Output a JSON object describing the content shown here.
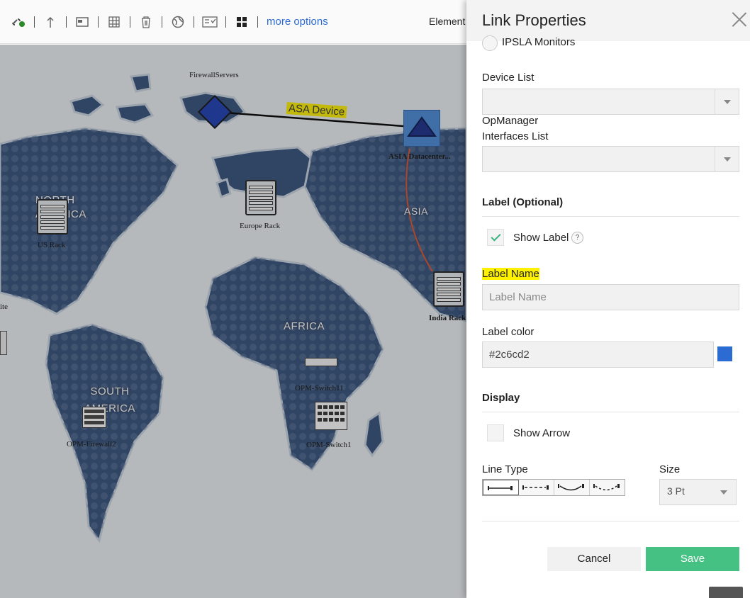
{
  "toolbar": {
    "more_options": "more options",
    "elements_label": "Element"
  },
  "map": {
    "continents": {
      "north_america": "NORTH AMERICA",
      "south_america": "SOUTH AMERICA",
      "africa": "AFRICA",
      "asia": "ASIA"
    },
    "devices": {
      "firewall_servers": "FirewallServers",
      "asia_datacenter": "ASIA Datacenter...",
      "us_rack": "US Rack",
      "europe_rack": "Europe Rack",
      "india_rack": "India Rack",
      "opm_switch11": "OPM-Switch11",
      "opm_switch1": "OPM-Switch1",
      "opm_firewall2": "OPM-Firewall2",
      "partial_left": "ite"
    },
    "link_label": "ASA Device"
  },
  "panel": {
    "title": "Link Properties",
    "ipsla_label": "IPSLA Monitors",
    "device_list_label": "Device List",
    "opmanager_label": "OpManager",
    "interfaces_list_label": "Interfaces List",
    "label_section": "Label (Optional)",
    "show_label": "Show Label",
    "show_label_help": "?",
    "label_name_label": "Label Name",
    "label_name_placeholder": "Label Name",
    "label_color_label": "Label color",
    "label_color_value": "#2c6cd2",
    "display_section": "Display",
    "show_arrow": "Show Arrow",
    "line_type_label": "Line Type",
    "size_label": "Size",
    "size_value": "3 Pt",
    "cancel": "Cancel",
    "save": "Save"
  },
  "colors": {
    "accent": "#2c6cd2",
    "save_green": "#45c283",
    "highlight": "#fff200"
  }
}
